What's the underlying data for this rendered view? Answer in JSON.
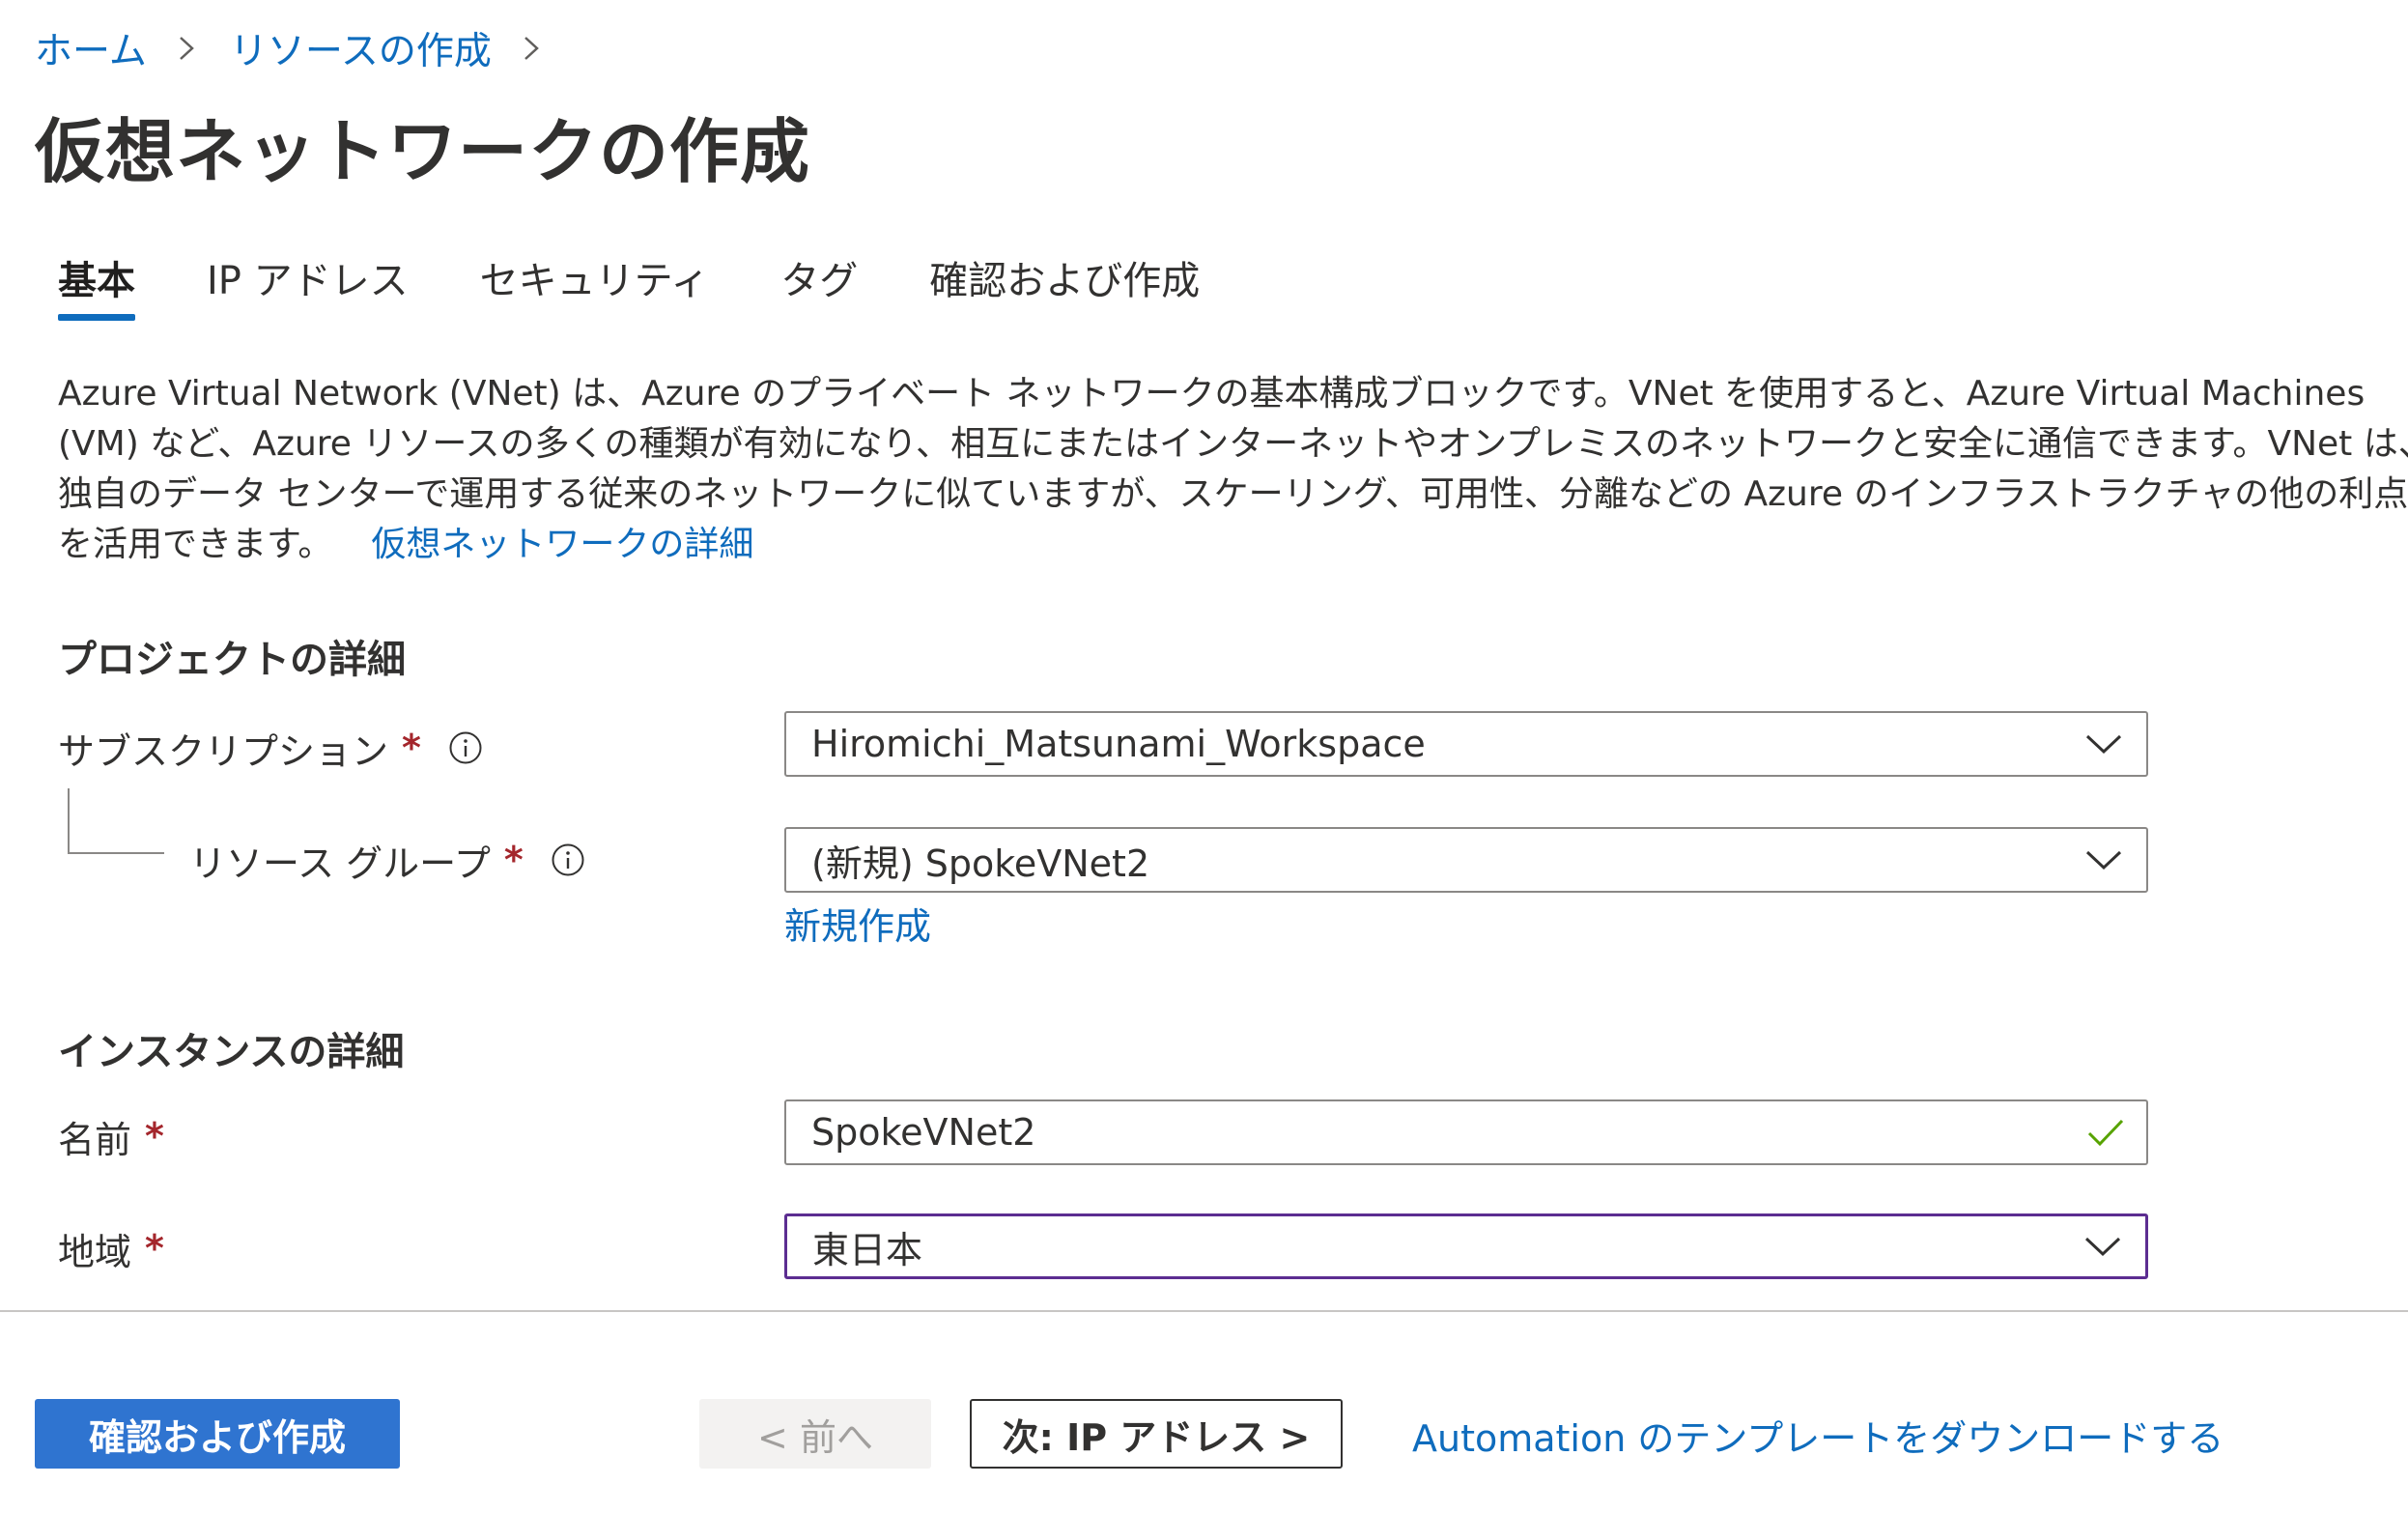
{
  "breadcrumb": {
    "items": [
      "ホーム",
      "リソースの作成"
    ]
  },
  "title": "仮想ネットワークの作成",
  "more_label": "…",
  "tabs": [
    {
      "label": "基本",
      "active": true
    },
    {
      "label": "IP アドレス",
      "active": false
    },
    {
      "label": "セキュリティ",
      "active": false
    },
    {
      "label": "タグ",
      "active": false
    },
    {
      "label": "確認および作成",
      "active": false
    }
  ],
  "description": {
    "lines": [
      "Azure Virtual Network (VNet) は、Azure のプライベート ネットワークの基本構成ブロックです。VNet を使用すると、Azure Virtual Machines",
      "(VM) など、Azure リソースの多くの種類が有効になり、相互にまたはインターネットやオンプレミスのネットワークと安全に通信できます。VNet は、",
      "独自のデータ センターで運用する従来のネットワークに似ていますが、スケーリング、可用性、分離などの Azure のインフラストラクチャの他の利点",
      "を活用できます。"
    ],
    "link": "仮想ネットワークの詳細"
  },
  "project": {
    "heading": "プロジェクトの詳細",
    "subscription": {
      "label": "サブスクリプション",
      "required": "*",
      "value": "Hiromichi_Matsunami_Workspace"
    },
    "resource_group": {
      "label": "リソース グループ",
      "required": "*",
      "value": "(新規) SpokeVNet2",
      "new_link": "新規作成"
    }
  },
  "instance": {
    "heading": "インスタンスの詳細",
    "name": {
      "label": "名前",
      "required": "*",
      "value": "SpokeVNet2"
    },
    "region": {
      "label": "地域",
      "required": "*",
      "value": "東日本"
    }
  },
  "footer": {
    "review_create": "確認および作成",
    "previous": "< 前へ",
    "next": "次: IP アドレス >",
    "automation_link": "Automation のテンプレートをダウンロードする"
  },
  "colors": {
    "link": "#0f6cbd",
    "primary_button": "#2f74d0",
    "required": "#a4262c",
    "valid_check": "#57a300",
    "focus_border": "#5c2d91"
  }
}
